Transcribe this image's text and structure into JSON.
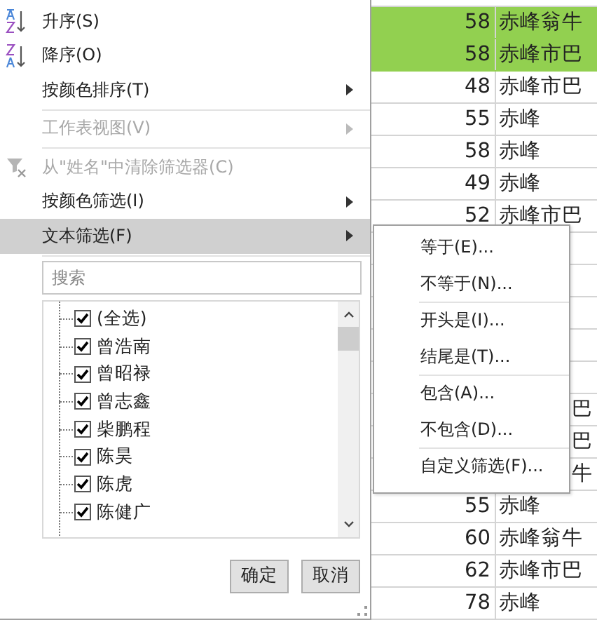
{
  "menu": {
    "items": [
      {
        "kind": "ascending",
        "label": "升序(S)",
        "disabled": false,
        "submenu": false,
        "selected": false
      },
      {
        "kind": "descending",
        "label": "降序(O)",
        "disabled": false,
        "submenu": false,
        "selected": false
      },
      {
        "kind": "item",
        "label": "按颜色排序(T)",
        "disabled": false,
        "submenu": true,
        "selected": false
      },
      {
        "kind": "separator"
      },
      {
        "kind": "item",
        "label": "工作表视图(V)",
        "disabled": true,
        "submenu": true,
        "selected": false
      },
      {
        "kind": "separator"
      },
      {
        "kind": "unfilter",
        "label": "从\"姓名\"中清除筛选器(C)",
        "disabled": true,
        "submenu": false,
        "selected": false
      },
      {
        "kind": "item",
        "label": "按颜色筛选(I)",
        "disabled": false,
        "submenu": true,
        "selected": false
      },
      {
        "kind": "item",
        "label": "文本筛选(F)",
        "disabled": false,
        "submenu": true,
        "selected": true
      },
      {
        "kind": "separator"
      }
    ]
  },
  "search": {
    "placeholder": "搜索"
  },
  "list": [
    {
      "label": "(全选)",
      "checked": true
    },
    {
      "label": "曾浩南",
      "checked": true
    },
    {
      "label": "曾昭禄",
      "checked": true
    },
    {
      "label": "曾志鑫",
      "checked": true
    },
    {
      "label": "柴鹏程",
      "checked": true
    },
    {
      "label": "陈昊",
      "checked": true
    },
    {
      "label": "陈虎",
      "checked": true
    },
    {
      "label": "陈健广",
      "checked": true
    }
  ],
  "buttons": [
    "确定",
    "取消"
  ],
  "submenu": {
    "items": [
      {
        "kind": "item",
        "label": "等于(E)..."
      },
      {
        "kind": "item",
        "label": "不等于(N)..."
      },
      {
        "kind": "separator"
      },
      {
        "kind": "item",
        "label": "开头是(I)..."
      },
      {
        "kind": "item",
        "label": "结尾是(T)..."
      },
      {
        "kind": "separator"
      },
      {
        "kind": "item",
        "label": "包含(A)..."
      },
      {
        "kind": "item",
        "label": "不包含(D)..."
      },
      {
        "kind": "separator"
      },
      {
        "kind": "item",
        "label": "自定义筛选(F)..."
      }
    ]
  },
  "sheet": {
    "rows": [
      {
        "kind": "full",
        "number": "58",
        "text": "赤峰翁牛",
        "highlighted": true
      },
      {
        "kind": "full",
        "number": "58",
        "text": "赤峰市巴",
        "highlighted": true
      },
      {
        "kind": "full",
        "number": "48",
        "text": "赤峰市巴",
        "highlighted": false
      },
      {
        "kind": "full",
        "number": "55",
        "text": "赤峰",
        "highlighted": false
      },
      {
        "kind": "full",
        "number": "58",
        "text": "赤峰",
        "highlighted": false
      },
      {
        "kind": "full",
        "number": "49",
        "text": "赤峰",
        "highlighted": false
      },
      {
        "kind": "full",
        "number": "52",
        "text": "赤峰市巴",
        "highlighted": false
      },
      {
        "kind": "covered"
      },
      {
        "kind": "covered"
      },
      {
        "kind": "covered"
      },
      {
        "kind": "covered"
      },
      {
        "kind": "covered"
      },
      {
        "kind": "tail",
        "text": "巴"
      },
      {
        "kind": "tail",
        "text": "巴"
      },
      {
        "kind": "tail",
        "text": "牛"
      },
      {
        "kind": "full",
        "number": "55",
        "text": "赤峰",
        "highlighted": false
      },
      {
        "kind": "full",
        "number": "60",
        "text": "赤峰翁牛",
        "highlighted": false
      },
      {
        "kind": "full",
        "number": "62",
        "text": "赤峰市巴",
        "highlighted": false
      },
      {
        "kind": "full",
        "number": "78",
        "text": "赤峰",
        "highlighted": false
      }
    ]
  }
}
